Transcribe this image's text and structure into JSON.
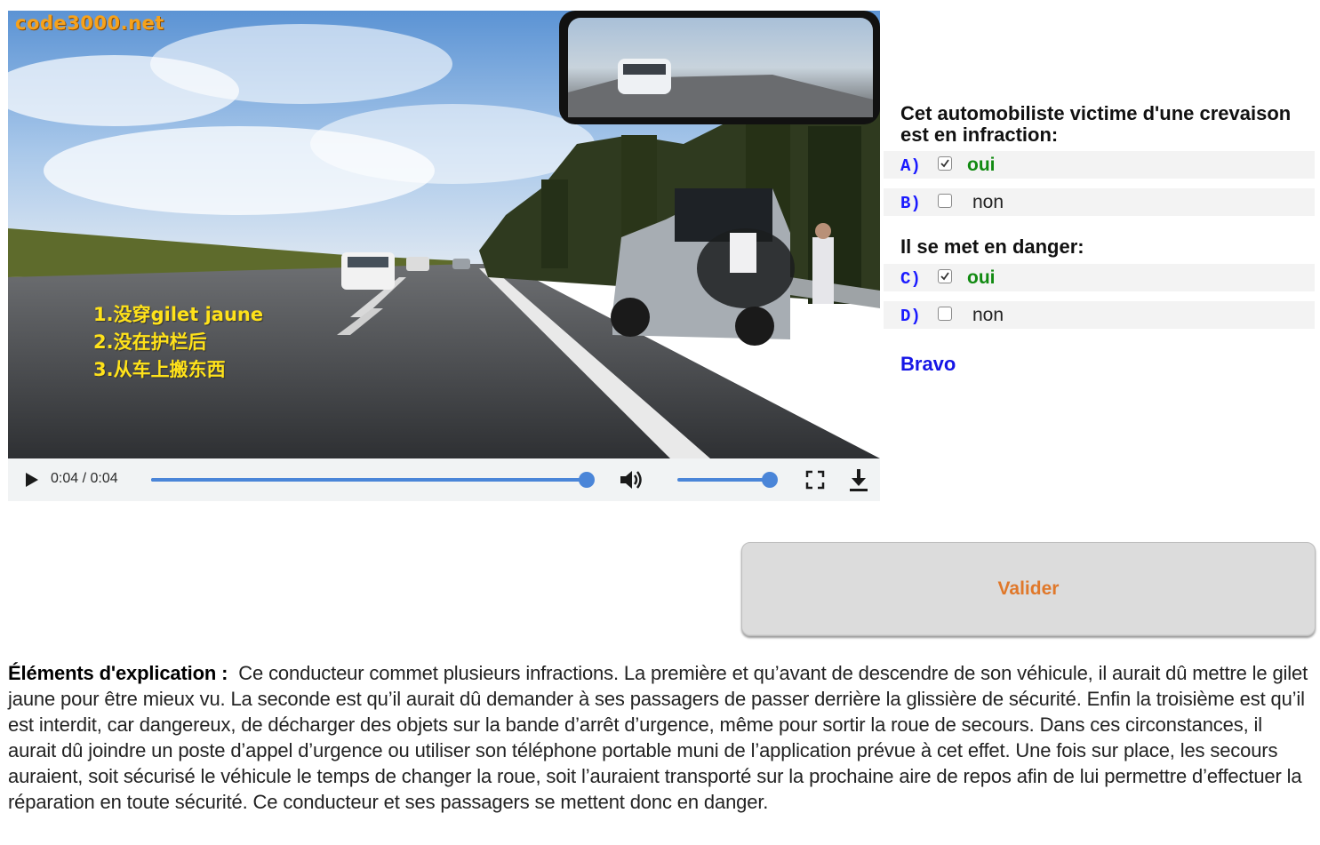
{
  "video": {
    "watermark": "code3000.net",
    "subtitles": [
      "1.没穿gilet jaune",
      "2.没在护栏后",
      "3.从车上搬东西"
    ],
    "time_display": "0:04 / 0:04",
    "progress_fraction": 1.0,
    "volume_fraction": 1.0,
    "icons": {
      "play": "play-icon",
      "volume": "volume-icon",
      "fullscreen": "fullscreen-icon",
      "download": "download-icon"
    }
  },
  "questions": [
    {
      "title": "Cet automobiliste victime d'une crevaison est en infraction:",
      "options": [
        {
          "letter": "A)",
          "label": "oui",
          "checked": true
        },
        {
          "letter": "B)",
          "label": "non",
          "checked": false
        }
      ]
    },
    {
      "title": "Il se met en danger:",
      "options": [
        {
          "letter": "C)",
          "label": "oui",
          "checked": true
        },
        {
          "letter": "D)",
          "label": "non",
          "checked": false
        }
      ]
    }
  ],
  "result": "Bravo",
  "valider_label": "Valider",
  "explanation": {
    "heading": "Éléments d'explication :",
    "text": "Ce conducteur commet plusieurs infractions. La première et qu’avant de descendre de son véhicule, il aurait dû mettre le gilet jaune pour être mieux vu. La seconde est qu’il aurait dû demander à ses passagers de passer derrière la glissière de sécurité. Enfin la troisième est qu’il est interdit, car dangereux, de décharger des objets sur la bande d’arrêt d’urgence, même pour sortir la roue de secours. Dans ces circonstances, il aurait dû joindre un poste d’appel d’urgence ou utiliser son téléphone portable muni de l’application prévue à cet effet. Une fois sur place, les secours auraient, soit sécurisé le véhicule le temps de changer la roue, soit l’auraient transporté sur la prochaine aire de repos afin de lui permettre d’effectuer la réparation en toute sécurité. Ce conducteur et ses passagers se mettent donc en danger."
  },
  "colors": {
    "accent_blue": "#4a85d8",
    "letter_blue": "#1a1aff",
    "correct_green": "#118a11",
    "bravo_blue": "#1515e6",
    "valider_text": "#e0782a",
    "subtitle_yellow": "#ffe21a",
    "watermark_orange": "#f6a21c"
  }
}
